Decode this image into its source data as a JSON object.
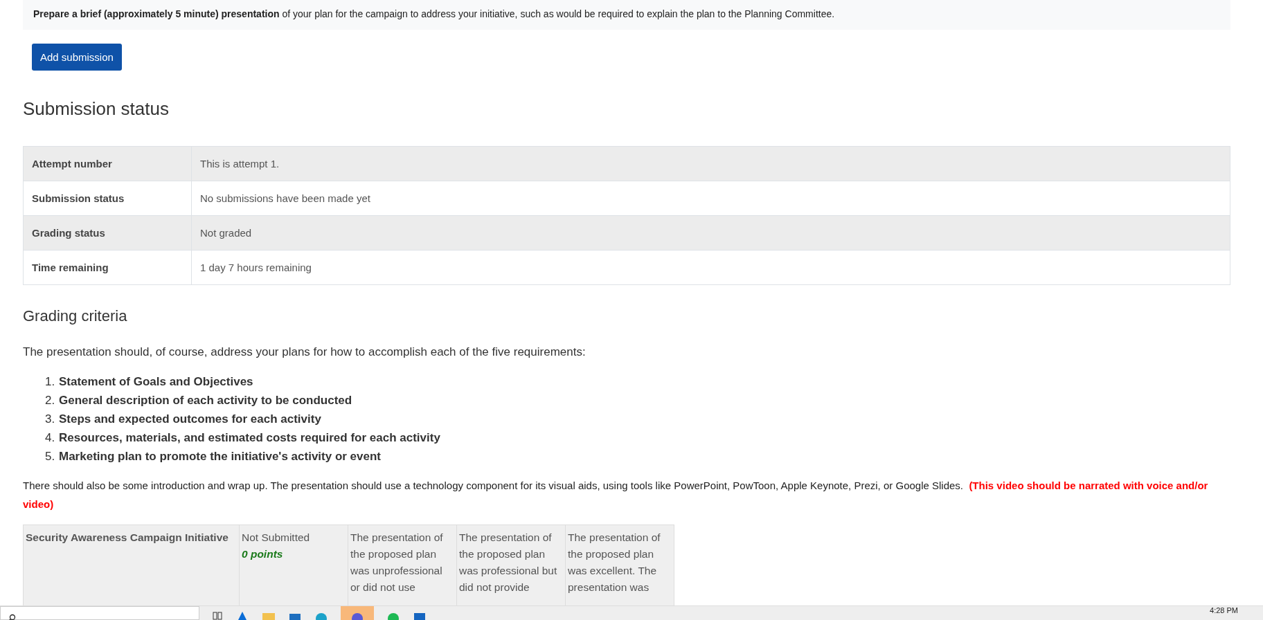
{
  "instructions": "**Prepare a brief (approximately 5 minute) presentation** of your plan for the campaign to address your initiative, such as would be required to explain the plan to the Planning Committee.",
  "add_button": "Add submission",
  "submission_status": {
    "heading": "Submission status",
    "rows": [
      {
        "label": "Attempt number",
        "value": "This is attempt 1."
      },
      {
        "label": "Submission status",
        "value": "No submissions have been made yet"
      },
      {
        "label": "Grading status",
        "value": "Not graded"
      },
      {
        "label": "Time remaining",
        "value": "1 day 7 hours remaining"
      }
    ]
  },
  "grading": {
    "heading": "Grading criteria",
    "intro": "The presentation should, of course, address your plans for how to accomplish each of the five requirements:",
    "requirements": [
      {
        "number": "1.",
        "text": "Statement of Goals and Objectives"
      },
      {
        "number": "2.",
        "text": "General description of each activity to be conducted"
      },
      {
        "number": "3.",
        "text": "Steps and expected outcomes for each activity"
      },
      {
        "number": "4.",
        "text": "Resources, materials, and estimated costs required for each activity"
      },
      {
        "number": "5.",
        "text": "Marketing plan to promote the initiative's activity or event"
      }
    ],
    "note": "There should also be some introduction and wrap up. The presentation should use a technology component for its visual aids, using tools like PowerPoint, PowToon, Apple Keynote, Prezi, or Google Slides.",
    "note_emphasis": "(This video should be narrated with voice and/or video)"
  },
  "rubric": {
    "criterion": "Security Awareness Campaign Initiative",
    "levels": [
      {
        "kind": "status",
        "text": "Not Submitted",
        "points": "0 points"
      },
      {
        "kind": "level",
        "text": "The presentation of the proposed plan was unprofessional or did not use"
      },
      {
        "kind": "level",
        "text": "The presentation of the proposed plan was professional but did not provide"
      },
      {
        "kind": "level",
        "text": "The presentation of the proposed plan was excellent. The presentation was"
      }
    ]
  },
  "taskbar": {
    "time": "4:28 PM"
  }
}
